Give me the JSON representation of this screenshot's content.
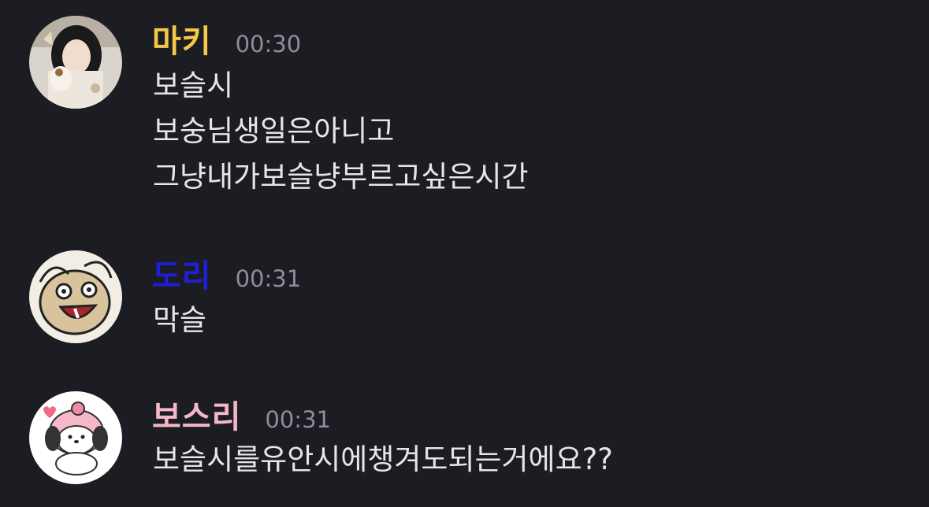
{
  "colors": {
    "background": "#1c1c23",
    "text": "#e6e6ea",
    "timestamp": "#8e8e99"
  },
  "messages": [
    {
      "username": "마키",
      "username_color": "#f5c84b",
      "timestamp": "00:30",
      "avatar_icon": "photo-avatar",
      "lines": [
        "보슬시",
        "보숭님생일은아니고",
        "그냥내가보슬냥부르고싶은시간"
      ]
    },
    {
      "username": "도리",
      "username_color": "#1f1fd6",
      "timestamp": "00:31",
      "avatar_icon": "cartoon-avatar",
      "lines": [
        "막슬"
      ]
    },
    {
      "username": "보스리",
      "username_color": "#f4b7c6",
      "timestamp": "00:31",
      "avatar_icon": "pochacco-avatar",
      "lines": [
        "보슬시를유안시에챙겨도되는거에요??"
      ]
    }
  ]
}
